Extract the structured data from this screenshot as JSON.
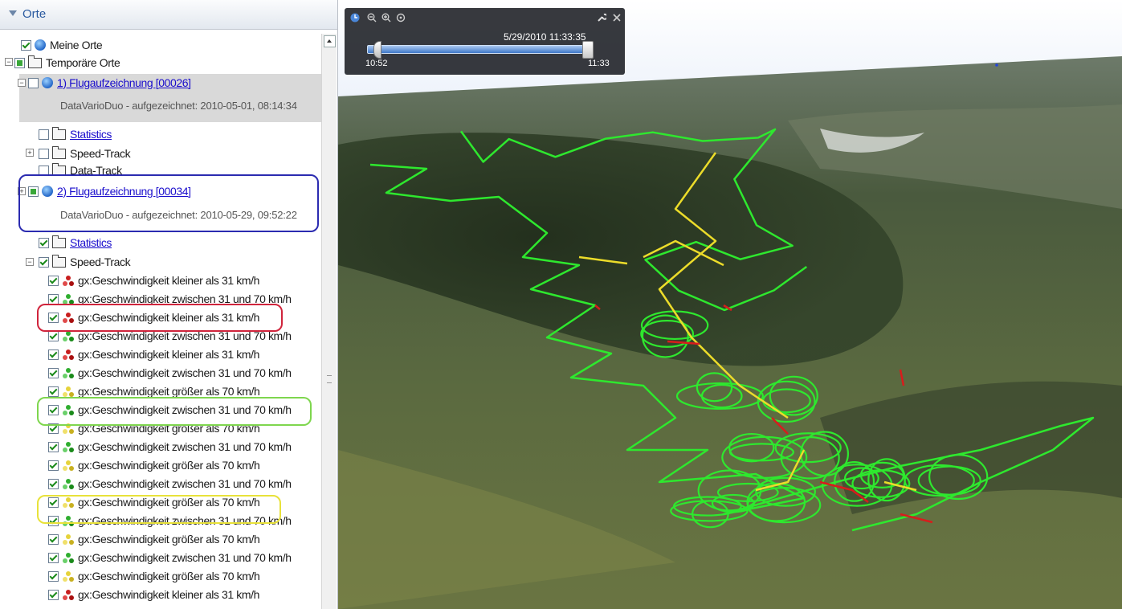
{
  "sidebar": {
    "title": "Orte",
    "items": {
      "meine_orte": "Meine Orte",
      "temp_orte": "Temporäre Orte",
      "flug1": "1) Flugaufzeichnung [00026]",
      "flug1_desc": "DataVarioDuo - aufgezeichnet: 2010-05-01, 08:14:34",
      "statistics1": "Statistics",
      "speed_track1": "Speed-Track",
      "data_track1": "Data-Track",
      "flug2": "2) Flugaufzeichnung [00034]",
      "flug2_desc": "DataVarioDuo - aufgezeichnet: 2010-05-29, 09:52:22",
      "statistics2": "Statistics",
      "speed_track2": "Speed-Track"
    },
    "speed_items": [
      {
        "label": "gx:Geschwindigkeit kleiner als 31 km/h",
        "color": "red"
      },
      {
        "label": "gx:Geschwindigkeit zwischen  31 und 70 km/h",
        "color": "green"
      },
      {
        "label": "gx:Geschwindigkeit kleiner als 31 km/h",
        "color": "red"
      },
      {
        "label": "gx:Geschwindigkeit zwischen  31 und 70 km/h",
        "color": "green"
      },
      {
        "label": "gx:Geschwindigkeit kleiner als 31 km/h",
        "color": "red"
      },
      {
        "label": "gx:Geschwindigkeit zwischen  31 und 70 km/h",
        "color": "green"
      },
      {
        "label": "gx:Geschwindigkeit größer als 70 km/h",
        "color": "yellow"
      },
      {
        "label": "gx:Geschwindigkeit zwischen  31 und 70 km/h",
        "color": "green"
      },
      {
        "label": "gx:Geschwindigkeit größer als 70 km/h",
        "color": "yellow"
      },
      {
        "label": "gx:Geschwindigkeit zwischen  31 und 70 km/h",
        "color": "green"
      },
      {
        "label": "gx:Geschwindigkeit größer als 70 km/h",
        "color": "yellow"
      },
      {
        "label": "gx:Geschwindigkeit zwischen  31 und 70 km/h",
        "color": "green"
      },
      {
        "label": "gx:Geschwindigkeit größer als 70 km/h",
        "color": "yellow"
      },
      {
        "label": "gx:Geschwindigkeit zwischen  31 und 70 km/h",
        "color": "green"
      },
      {
        "label": "gx:Geschwindigkeit größer als 70 km/h",
        "color": "yellow"
      },
      {
        "label": "gx:Geschwindigkeit zwischen  31 und 70 km/h",
        "color": "green"
      },
      {
        "label": "gx:Geschwindigkeit größer als 70 km/h",
        "color": "yellow"
      },
      {
        "label": "gx:Geschwindigkeit kleiner als 31 km/h",
        "color": "red"
      }
    ],
    "highlight_colors": {
      "blue": "#2b2bb0",
      "red": "#d0243c",
      "green": "#7ed64e",
      "yellow": "#e8e23a"
    }
  },
  "timebar": {
    "date": "5/29/2010  11:33:35",
    "start": "10:52",
    "end": "11:33",
    "icons": [
      "clock-icon",
      "zoom-out-icon",
      "zoom-in-icon",
      "reset-icon",
      "wrench-icon",
      "close-icon"
    ]
  },
  "track_colors": {
    "fast": "#ecdc2a",
    "medium": "#2ee82e",
    "slow": "#d81c1c"
  }
}
